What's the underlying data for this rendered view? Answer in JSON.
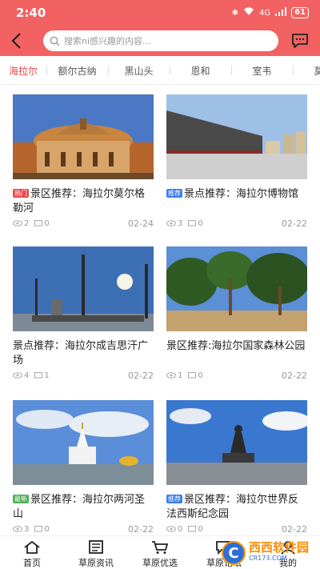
{
  "status_bar": {
    "time": "2:40",
    "battery": "61",
    "network": "4G"
  },
  "search": {
    "placeholder": "搜索ni感兴趣的内容..."
  },
  "tabs": [
    "海拉尔",
    "额尔古纳",
    "黑山头",
    "恩和",
    "室韦",
    "莫尔"
  ],
  "active_tab": 0,
  "cards": [
    {
      "badge": "热门",
      "badge_color": "#e84b4b",
      "title": "景区推荐：海拉尔莫尔格勒河",
      "views": "2",
      "comments": "0",
      "date": "02-24"
    },
    {
      "badge": "推荐",
      "badge_color": "#3a7ee8",
      "title": "景点推荐：海拉尔博物馆",
      "views": "3",
      "comments": "0",
      "date": "02-22"
    },
    {
      "badge": "",
      "badge_color": "",
      "title": "景点推荐：海拉尔成吉思汗广场",
      "views": "4",
      "comments": "1",
      "date": "02-22"
    },
    {
      "badge": "",
      "badge_color": "",
      "title": "景区推荐:海拉尔国家森林公园",
      "views": "1",
      "comments": "0",
      "date": "02-22"
    },
    {
      "badge": "最新",
      "badge_color": "#4caf50",
      "title": "景区推荐：海拉尔两河圣山",
      "views": "3",
      "comments": "0",
      "date": "02-22"
    },
    {
      "badge": "推荐",
      "badge_color": "#3a7ee8",
      "title": "景区推荐：海拉尔世界反法西斯纪念园",
      "views": "0",
      "comments": "0",
      "date": "02-22"
    }
  ],
  "bottom_nav": [
    "首页",
    "草原资讯",
    "草原优选",
    "草原论坛",
    "我的"
  ],
  "watermark": {
    "brand": "西西软件园",
    "sub": "CR173.COM",
    "logo_text": "C"
  },
  "colors": {
    "accent": "#f26262",
    "active_tab": "#e64545"
  }
}
